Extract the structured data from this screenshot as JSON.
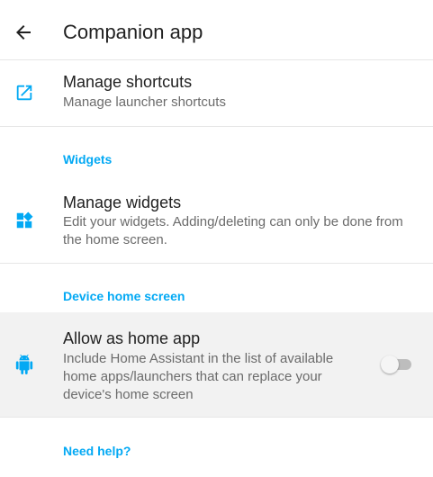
{
  "appbar": {
    "title": "Companion app"
  },
  "shortcuts": {
    "title": "Manage shortcuts",
    "summary": "Manage launcher shortcuts"
  },
  "widgets_category": "Widgets",
  "widgets": {
    "title": "Manage widgets",
    "summary": "Edit your widgets. Adding/deleting can only be done from the home screen."
  },
  "home_category": "Device home screen",
  "home_app": {
    "title": "Allow as home app",
    "summary": "Include Home Assistant in the list of available home apps/launchers that can replace your device's home screen",
    "enabled": false
  },
  "help_category": "Need help?",
  "colors": {
    "accent": "#03a9f4",
    "icon": "#03a9f4"
  },
  "icons": {
    "back": "arrow-left-icon",
    "shortcuts": "open-in-new-icon",
    "widgets": "widgets-icon",
    "home_app": "android-icon"
  }
}
